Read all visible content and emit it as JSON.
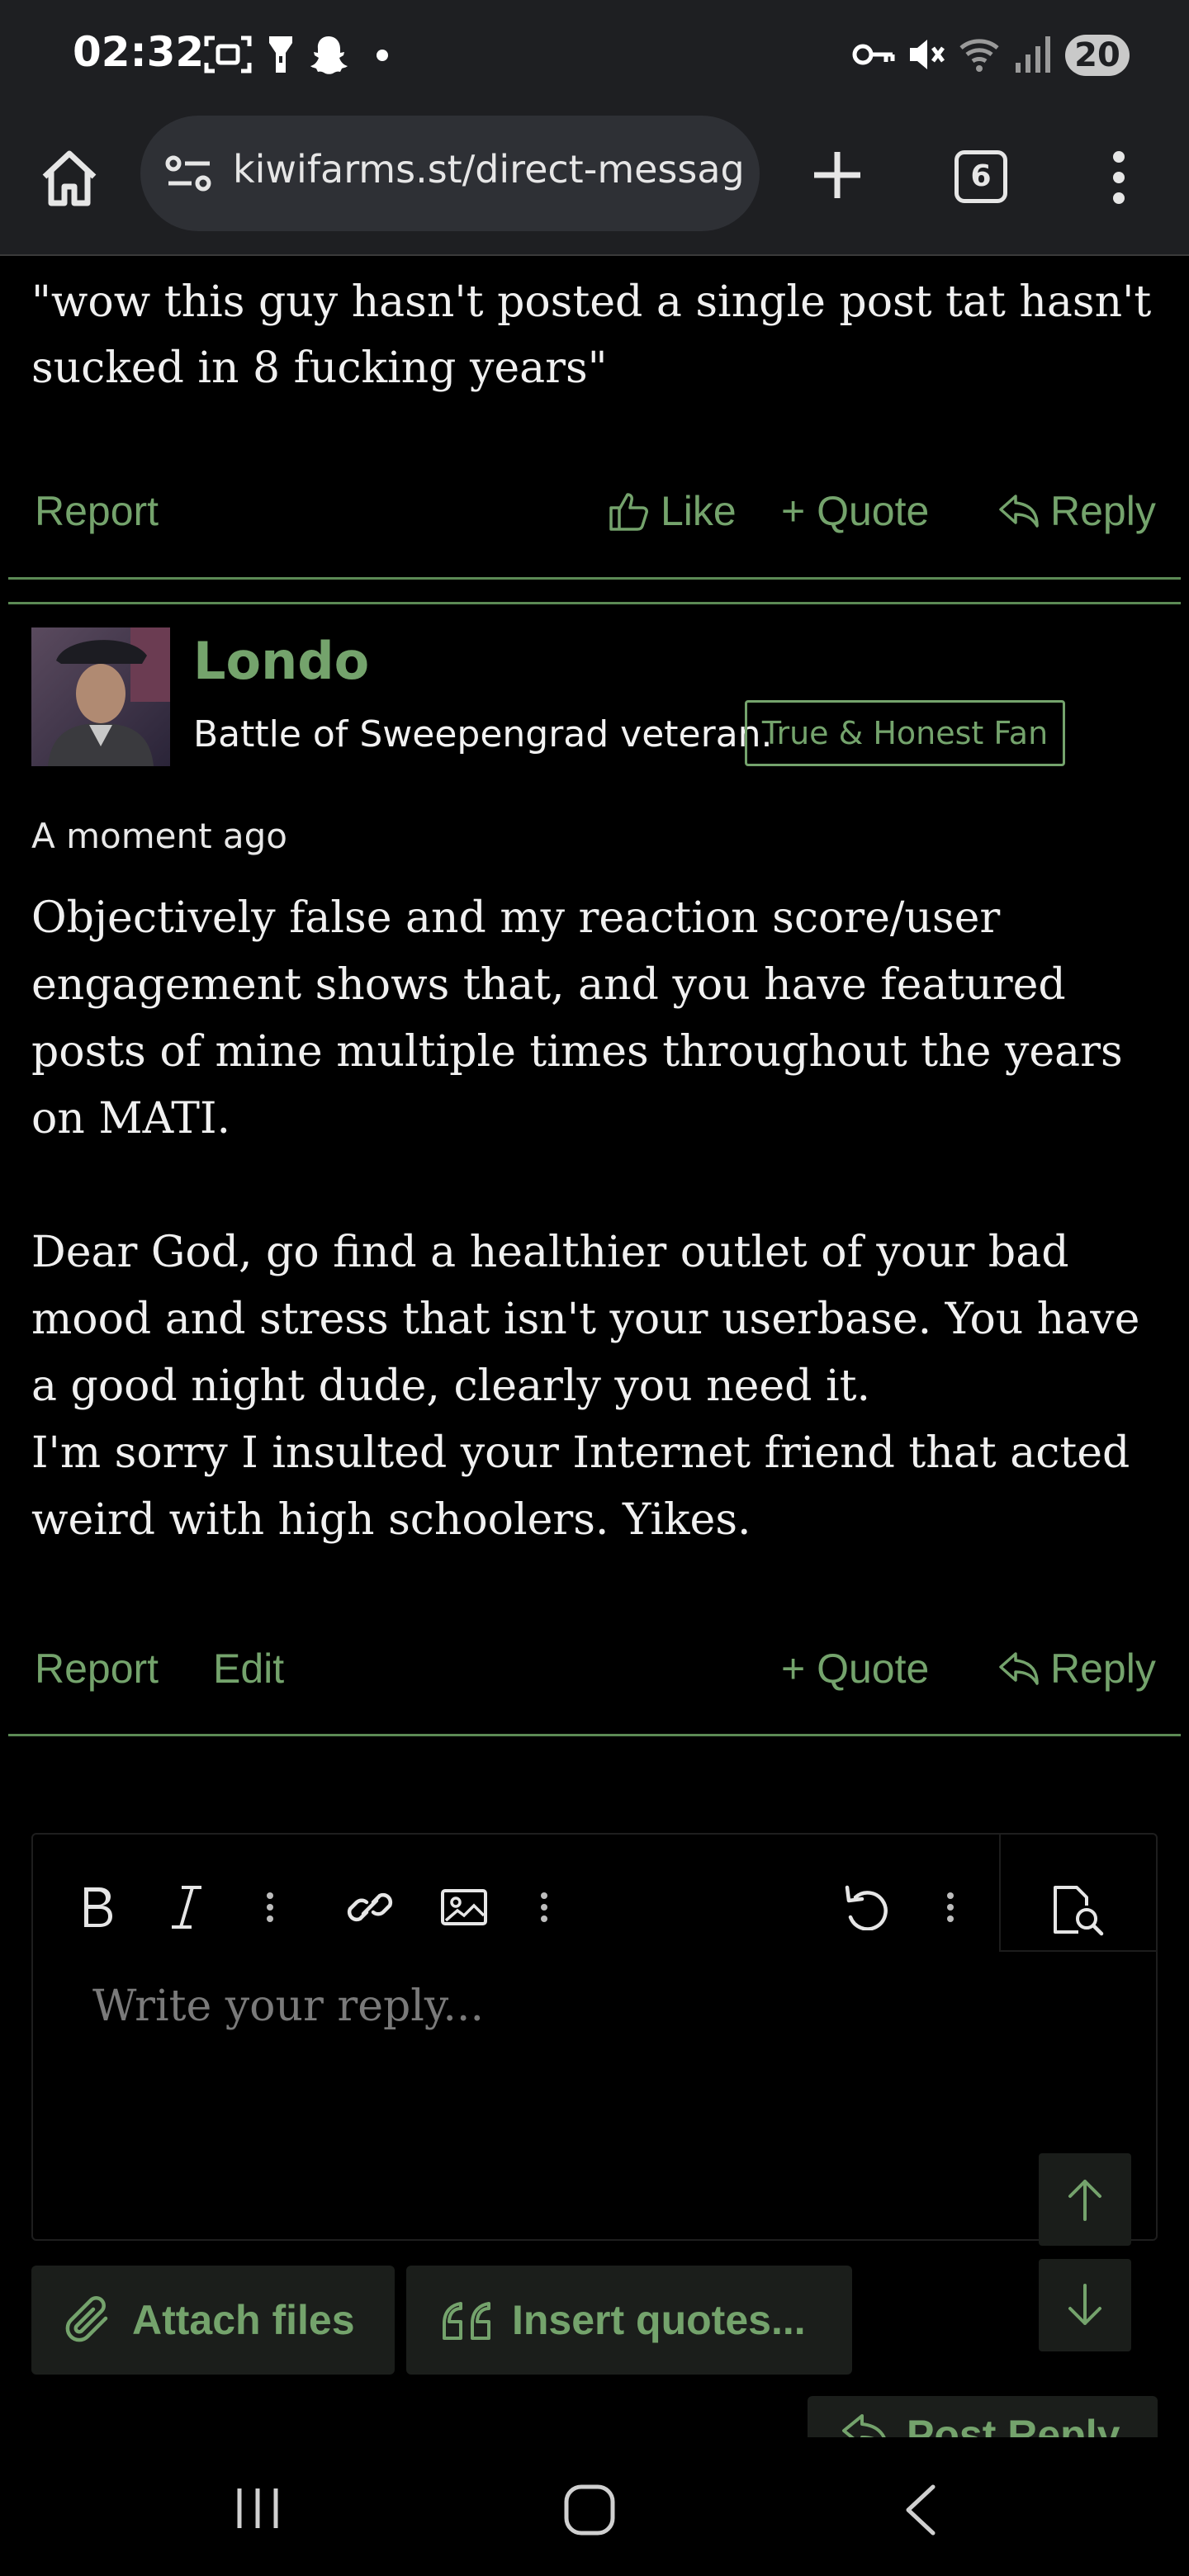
{
  "status_bar": {
    "time": "02:32",
    "battery": "20",
    "icons": [
      "screenshot-icon",
      "flashlight-icon",
      "snapchat-icon",
      "dot-icon",
      "key-icon",
      "mute-icon",
      "wifi-icon",
      "signal-icon"
    ]
  },
  "browser": {
    "url": "kiwifarms.st/direct-messag",
    "tab_count": "6"
  },
  "previous_message": {
    "text": "\"wow this guy hasn't posted a single post tat hasn't sucked in 8 fucking years\"",
    "actions": {
      "report": "Report",
      "like": "Like",
      "quote": "+ Quote",
      "reply": "Reply"
    }
  },
  "message": {
    "username": "Londo",
    "user_title": "Battle of Sweepengrad veteran.",
    "user_badge": "True & Honest Fan",
    "time": "A moment ago",
    "paragraphs": [
      "Objectively false and my reaction score/user engagement shows that, and you have featured posts of mine multiple times throughout the years on MATI.",
      "Dear God, go find a healthier outlet of your bad mood and stress that isn't your userbase. You have a good night dude, clearly you need it.",
      "I'm sorry I insulted your Internet friend that acted weird with high schoolers. Yikes."
    ],
    "actions": {
      "report": "Report",
      "edit": "Edit",
      "quote": "+ Quote",
      "reply": "Reply"
    }
  },
  "editor": {
    "placeholder": "Write your reply..."
  },
  "buttons": {
    "attach": "Attach files",
    "insert_quotes": "Insert quotes...",
    "post_reply": "Post Reply"
  },
  "colors": {
    "accent": "#74a36c",
    "background": "#000000",
    "chrome": "#1e1f22"
  }
}
